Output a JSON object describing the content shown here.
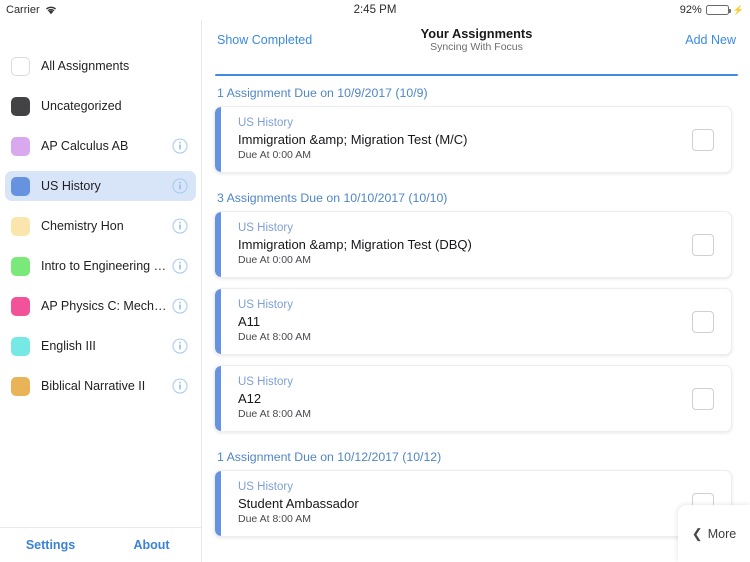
{
  "status_bar": {
    "carrier": "Carrier",
    "wifi_icon": "wifi-icon",
    "time": "2:45 PM",
    "battery_percent": "92%",
    "battery_level": 92,
    "battery_color": "#4cd964",
    "charging_icon": "lightning-bolt-icon"
  },
  "sidebar": {
    "courses": [
      {
        "label": "All Assignments",
        "color": "#ffffff",
        "has_info": false,
        "selected": false
      },
      {
        "label": "Uncategorized",
        "color": "#434345",
        "has_info": false,
        "selected": false
      },
      {
        "label": "AP Calculus AB",
        "color": "#d9a9f0",
        "has_info": true,
        "selected": false
      },
      {
        "label": "US History",
        "color": "#6693e0",
        "has_info": true,
        "selected": true
      },
      {
        "label": "Chemistry Hon",
        "color": "#fae6ac",
        "has_info": true,
        "selected": false
      },
      {
        "label": "Intro to Engineering Design…",
        "color": "#7ae97a",
        "has_info": true,
        "selected": false
      },
      {
        "label": "AP Physics C: Mechanics",
        "color": "#f2529a",
        "has_info": true,
        "selected": false
      },
      {
        "label": "English III",
        "color": "#77e9e4",
        "has_info": true,
        "selected": false
      },
      {
        "label": "Biblical Narrative II",
        "color": "#e8b457",
        "has_info": true,
        "selected": false
      }
    ],
    "footer": {
      "settings_label": "Settings",
      "about_label": "About"
    }
  },
  "topbar": {
    "show_completed_label": "Show Completed",
    "title": "Your Assignments",
    "subtitle": "Syncing With Focus",
    "add_new_label": "Add New",
    "accent_color": "#3f8ce0"
  },
  "sections": [
    {
      "heading": "1 Assignment Due on 10/9/2017 (10/9)",
      "assignments": [
        {
          "course": "US History",
          "title": "Immigration &amp; Migration Test (M/C)",
          "due": "Due At 0:00 AM",
          "accent": "#6693e0",
          "checked": false
        }
      ]
    },
    {
      "heading": "3 Assignments Due on 10/10/2017 (10/10)",
      "assignments": [
        {
          "course": "US History",
          "title": "Immigration &amp; Migration Test (DBQ)",
          "due": "Due At 0:00 AM",
          "accent": "#6693e0",
          "checked": false
        },
        {
          "course": "US History",
          "title": "A11",
          "due": "Due At 8:00 AM",
          "accent": "#6693e0",
          "checked": false
        },
        {
          "course": "US History",
          "title": "A12",
          "due": "Due At 8:00 AM",
          "accent": "#6693e0",
          "checked": false
        }
      ]
    },
    {
      "heading": "1 Assignment Due on 10/12/2017 (10/12)",
      "assignments": [
        {
          "course": "US History",
          "title": "Student Ambassador",
          "due": "Due At 8:00 AM",
          "accent": "#6693e0",
          "checked": false
        }
      ]
    }
  ],
  "more_panel": {
    "chevron_icon": "chevron-left-icon",
    "label": "More"
  }
}
